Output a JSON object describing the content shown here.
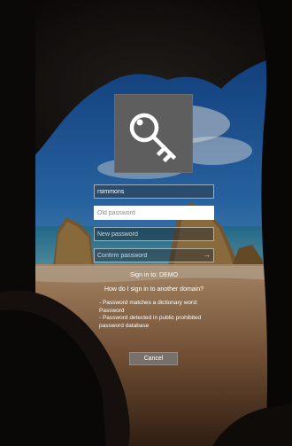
{
  "login": {
    "username_value": "rsimmons",
    "old_password_placeholder": "Old password",
    "new_password_placeholder": "New password",
    "confirm_password_placeholder": "Confirm password",
    "signin_to": "Sign in to: DEMO",
    "other_domain_link": "How do I sign in to another domain?",
    "errors": [
      "- Password matches a dictionary word:",
      "Password",
      "- Password detected in public prohibited",
      "password database"
    ],
    "cancel_label": "Cancel"
  },
  "icons": {
    "tile": "key-icon",
    "submit": "arrow-right-icon"
  },
  "colors": {
    "tile_background": "#5e5e5e",
    "cancel_background": "#787878"
  }
}
